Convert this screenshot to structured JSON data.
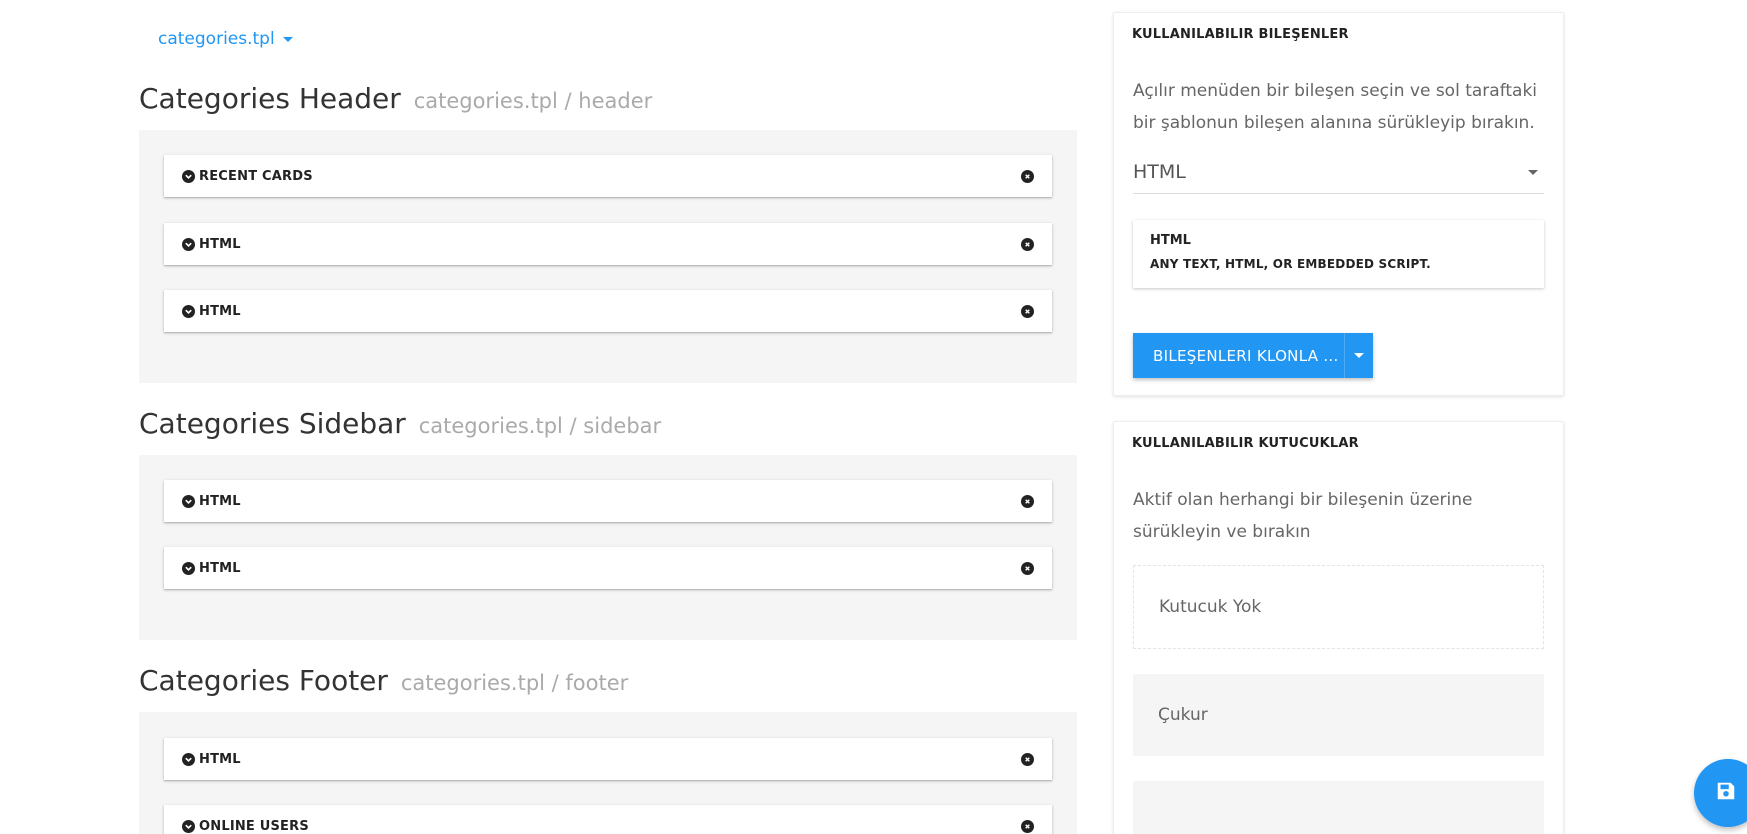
{
  "template_selector": {
    "label": "categories.tpl"
  },
  "areas": [
    {
      "title": "Categories Header",
      "subtitle": "categories.tpl / header",
      "widgets": [
        "RECENT CARDS",
        "HTML",
        "HTML"
      ]
    },
    {
      "title": "Categories Sidebar",
      "subtitle": "categories.tpl / sidebar",
      "widgets": [
        "HTML",
        "HTML"
      ]
    },
    {
      "title": "Categories Footer",
      "subtitle": "categories.tpl / footer",
      "widgets": [
        "HTML",
        "ONLINE USERS"
      ]
    }
  ],
  "available_widgets": {
    "heading": "KULLANILABILIR BILEŞENLER",
    "description": "Açılır menüden bir bileşen seçin ve sol taraftaki bir şablonun bileşen alanına sürükleyip bırakın.",
    "selected": "HTML",
    "card": {
      "name": "HTML",
      "description": "ANY TEXT, HTML, OR EMBEDDED SCRIPT."
    },
    "clone_button": "BILEŞENLERI KLONLA ..."
  },
  "available_containers": {
    "heading": "KULLANILABILIR KUTUCUKLAR",
    "description": "Aktif olan herhangi bir bileşenin üzerine sürükleyin ve bırakın",
    "items": [
      "Kutucuk Yok",
      "Çukur",
      ""
    ]
  },
  "colors": {
    "accent": "#2196f3",
    "area_bg": "#f5f5f5"
  },
  "icons": {
    "widget_toggle": "chevron-circle-down-icon",
    "widget_remove": "times-circle-icon",
    "save": "floppy-disk-icon"
  }
}
